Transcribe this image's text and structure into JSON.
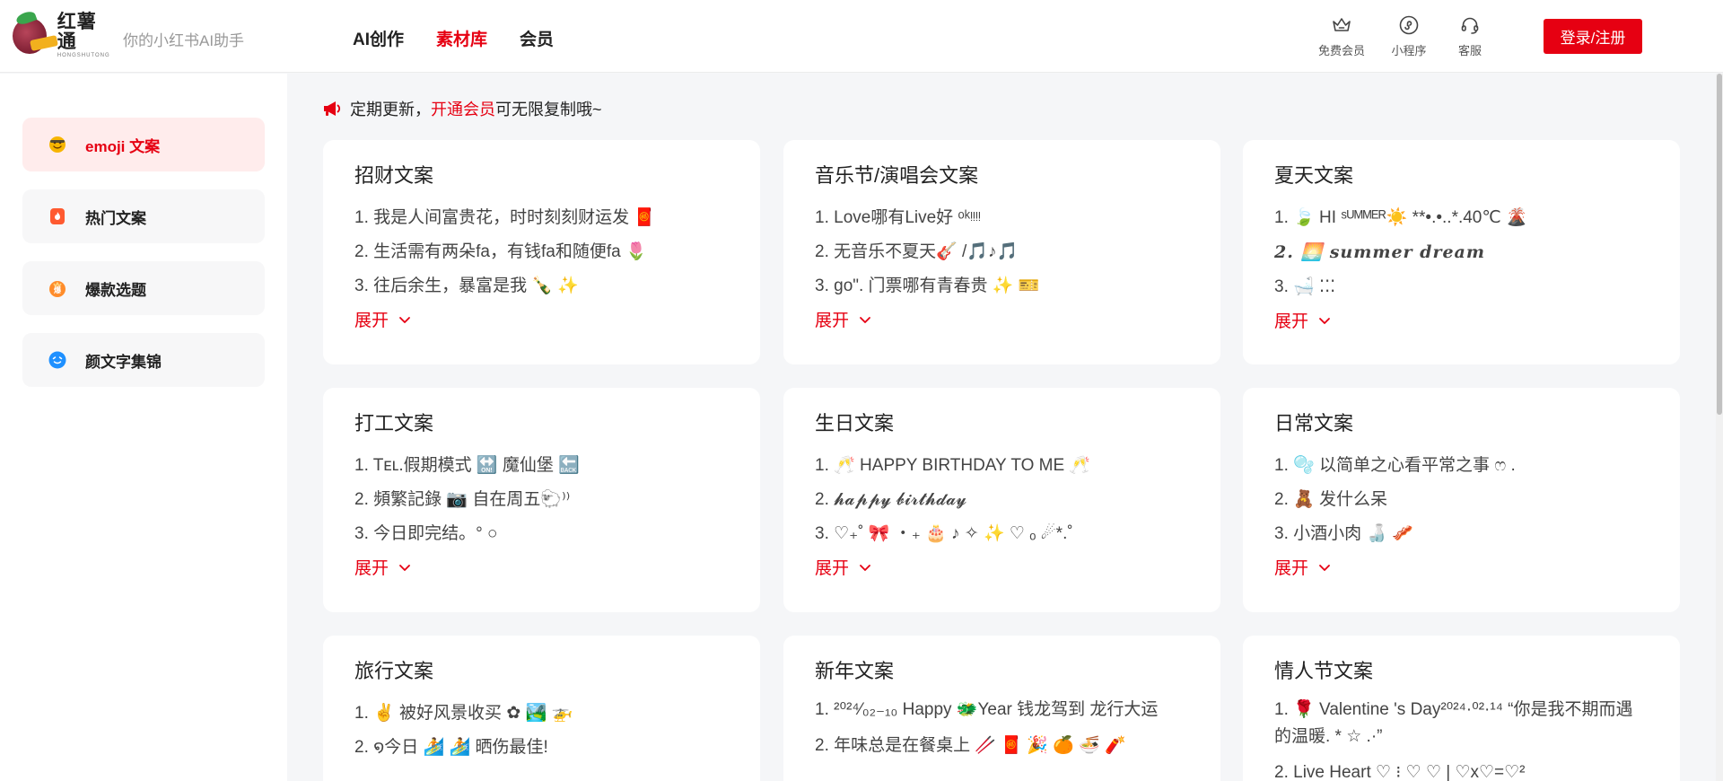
{
  "header": {
    "logo_name": "红薯通",
    "logo_sub": "HONGSHUTONG",
    "slogan": "你的小红书AI助手",
    "nav": [
      {
        "label": "AI创作"
      },
      {
        "label": "素材库",
        "active": true
      },
      {
        "label": "会员"
      }
    ],
    "icons": [
      {
        "label": "免费会员",
        "icon": "crown-icon"
      },
      {
        "label": "小程序",
        "icon": "miniprogram-icon"
      },
      {
        "label": "客服",
        "icon": "headset-icon"
      }
    ],
    "login_label": "登录/注册"
  },
  "sidebar": {
    "items": [
      {
        "label": "emoji 文案",
        "icon": "emoji-face-icon",
        "active": true
      },
      {
        "label": "热门文案",
        "icon": "fire-icon"
      },
      {
        "label": "爆款选题",
        "icon": "explosion-icon"
      },
      {
        "label": "颜文字集锦",
        "icon": "kaomoji-face-icon"
      }
    ]
  },
  "notice": {
    "prefix": "定期更新，",
    "link": "开通会员",
    "suffix": "可无限复制哦~"
  },
  "expand_label": "展开",
  "cards": [
    {
      "title": "招财文案",
      "lines": [
        "1. 我是人间富贵花，时时刻刻财运发 🧧",
        "2. 生活需有两朵fa，有钱fa和随便fa 🌷",
        "3. 往后余生，暴富是我 🍾 ✨"
      ]
    },
    {
      "title": "音乐节/演唱会文案",
      "lines": [
        "1. Love哪有Live好 ᵒᵏᵎᵎᵎᵎ",
        "2. 无音乐不夏天🎸 /🎵♪🎵",
        "3. go\". 门票哪有青春贵 ✨ 🎫"
      ]
    },
    {
      "title": "夏天文案",
      "lines": [
        "1. 🍃 HI ˢᵁᴹᴹᴱᴿ☀️ **•.•..*.40℃ 🌋",
        "2. 🌅 summer dream",
        "3. 🛁 ⁚⁚⁚"
      ]
    },
    {
      "title": "打工文案",
      "lines": [
        "1. Tᴇʟ.假期模式 🔛 魔仙堡 🔙",
        "2. 頻繁記錄 📷 自在周五🐑⁾⁾",
        "3. 今日即完结。° ○"
      ]
    },
    {
      "title": "生日文案",
      "lines": [
        "1. 🥂 HAPPY BIRTHDAY TO ME 🥂",
        "2. 𝓱𝓪𝓹𝓹𝔂 𝓫𝓲𝓻𝓽𝓱𝓭𝓪𝔂",
        "3. ♡₊˚ 🎀 ・₊ 🎂 ♪ ✧ ✨ ♡ ₒ ☄︎*.˚"
      ]
    },
    {
      "title": "日常文案",
      "lines": [
        "1. 🫧 以简单之心看平常之事 ෆ .",
        "2. 🧸 发什么呆",
        "3. 小酒小肉 🍶 🥓"
      ]
    },
    {
      "title": "旅行文案",
      "lines": [
        "1. ✌️ 被好风景收买 ✿ 🏞️ 🚁",
        "2. ໑今日 🏄 🏄 晒伤最佳!"
      ]
    },
    {
      "title": "新年文案",
      "lines": [
        "1. ²⁰²⁴⁄₀₂₋₁₀ Happy 🐲Year 钱龙驾到 龙行大运",
        "2. 年味总是在餐桌上 🥢 🧧 🎉 🍊 🍜 🧨"
      ]
    },
    {
      "title": "情人节文案",
      "lines": [
        "1. 🌹 Valentine 's Day²⁰²⁴·⁰²·¹⁴ “你是我不期而遇的温暖. * ☆ .·”",
        "2. Live Heart ♡ ⁝ ♡ ♡ | ♡x♡=♡²"
      ]
    }
  ]
}
